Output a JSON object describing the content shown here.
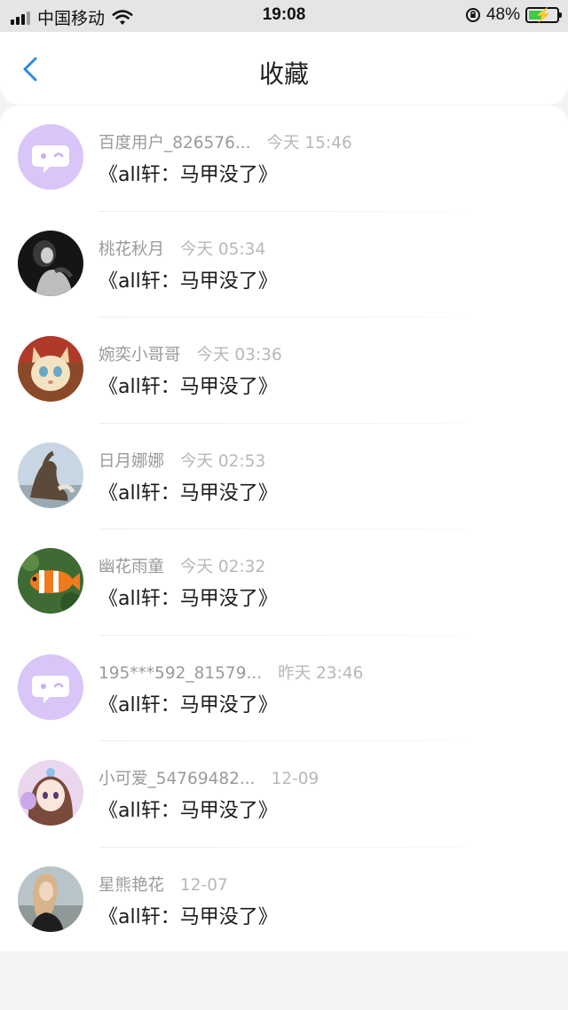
{
  "status_bar": {
    "carrier": "中国移动",
    "time": "19:08",
    "battery": "48%"
  },
  "header": {
    "title": "收藏"
  },
  "favorites": [
    {
      "user": "百度用户_826576...",
      "time": "今天 15:46",
      "title": "《all轩：马甲没了》",
      "avatar": "default-avatar"
    },
    {
      "user": "桃花秋月",
      "time": "今天 05:34",
      "title": "《all轩：马甲没了》",
      "avatar": "photo-avatar"
    },
    {
      "user": "婉奕小哥哥",
      "time": "今天 03:36",
      "title": "《all轩：马甲没了》",
      "avatar": "cat-avatar"
    },
    {
      "user": "日月娜娜",
      "time": "今天 02:53",
      "title": "《all轩：马甲没了》",
      "avatar": "cat-avatar"
    },
    {
      "user": "幽花雨童",
      "time": "今天 02:32",
      "title": "《all轩：马甲没了》",
      "avatar": "clownfish-avatar"
    },
    {
      "user": "195***592_81579...",
      "time": "昨天 23:46",
      "title": "《all轩：马甲没了》",
      "avatar": "default-avatar"
    },
    {
      "user": "小可爱_54769482...",
      "time": "12-09",
      "title": "《all轩：马甲没了》",
      "avatar": "anime-girl-avatar"
    },
    {
      "user": "星熊艳花",
      "time": "12-07",
      "title": "《all轩：马甲没了》",
      "avatar": "photo-avatar"
    }
  ],
  "colors": {
    "accent": "#2b8ae6",
    "default_avatar_bg": "#d9c5f7"
  }
}
